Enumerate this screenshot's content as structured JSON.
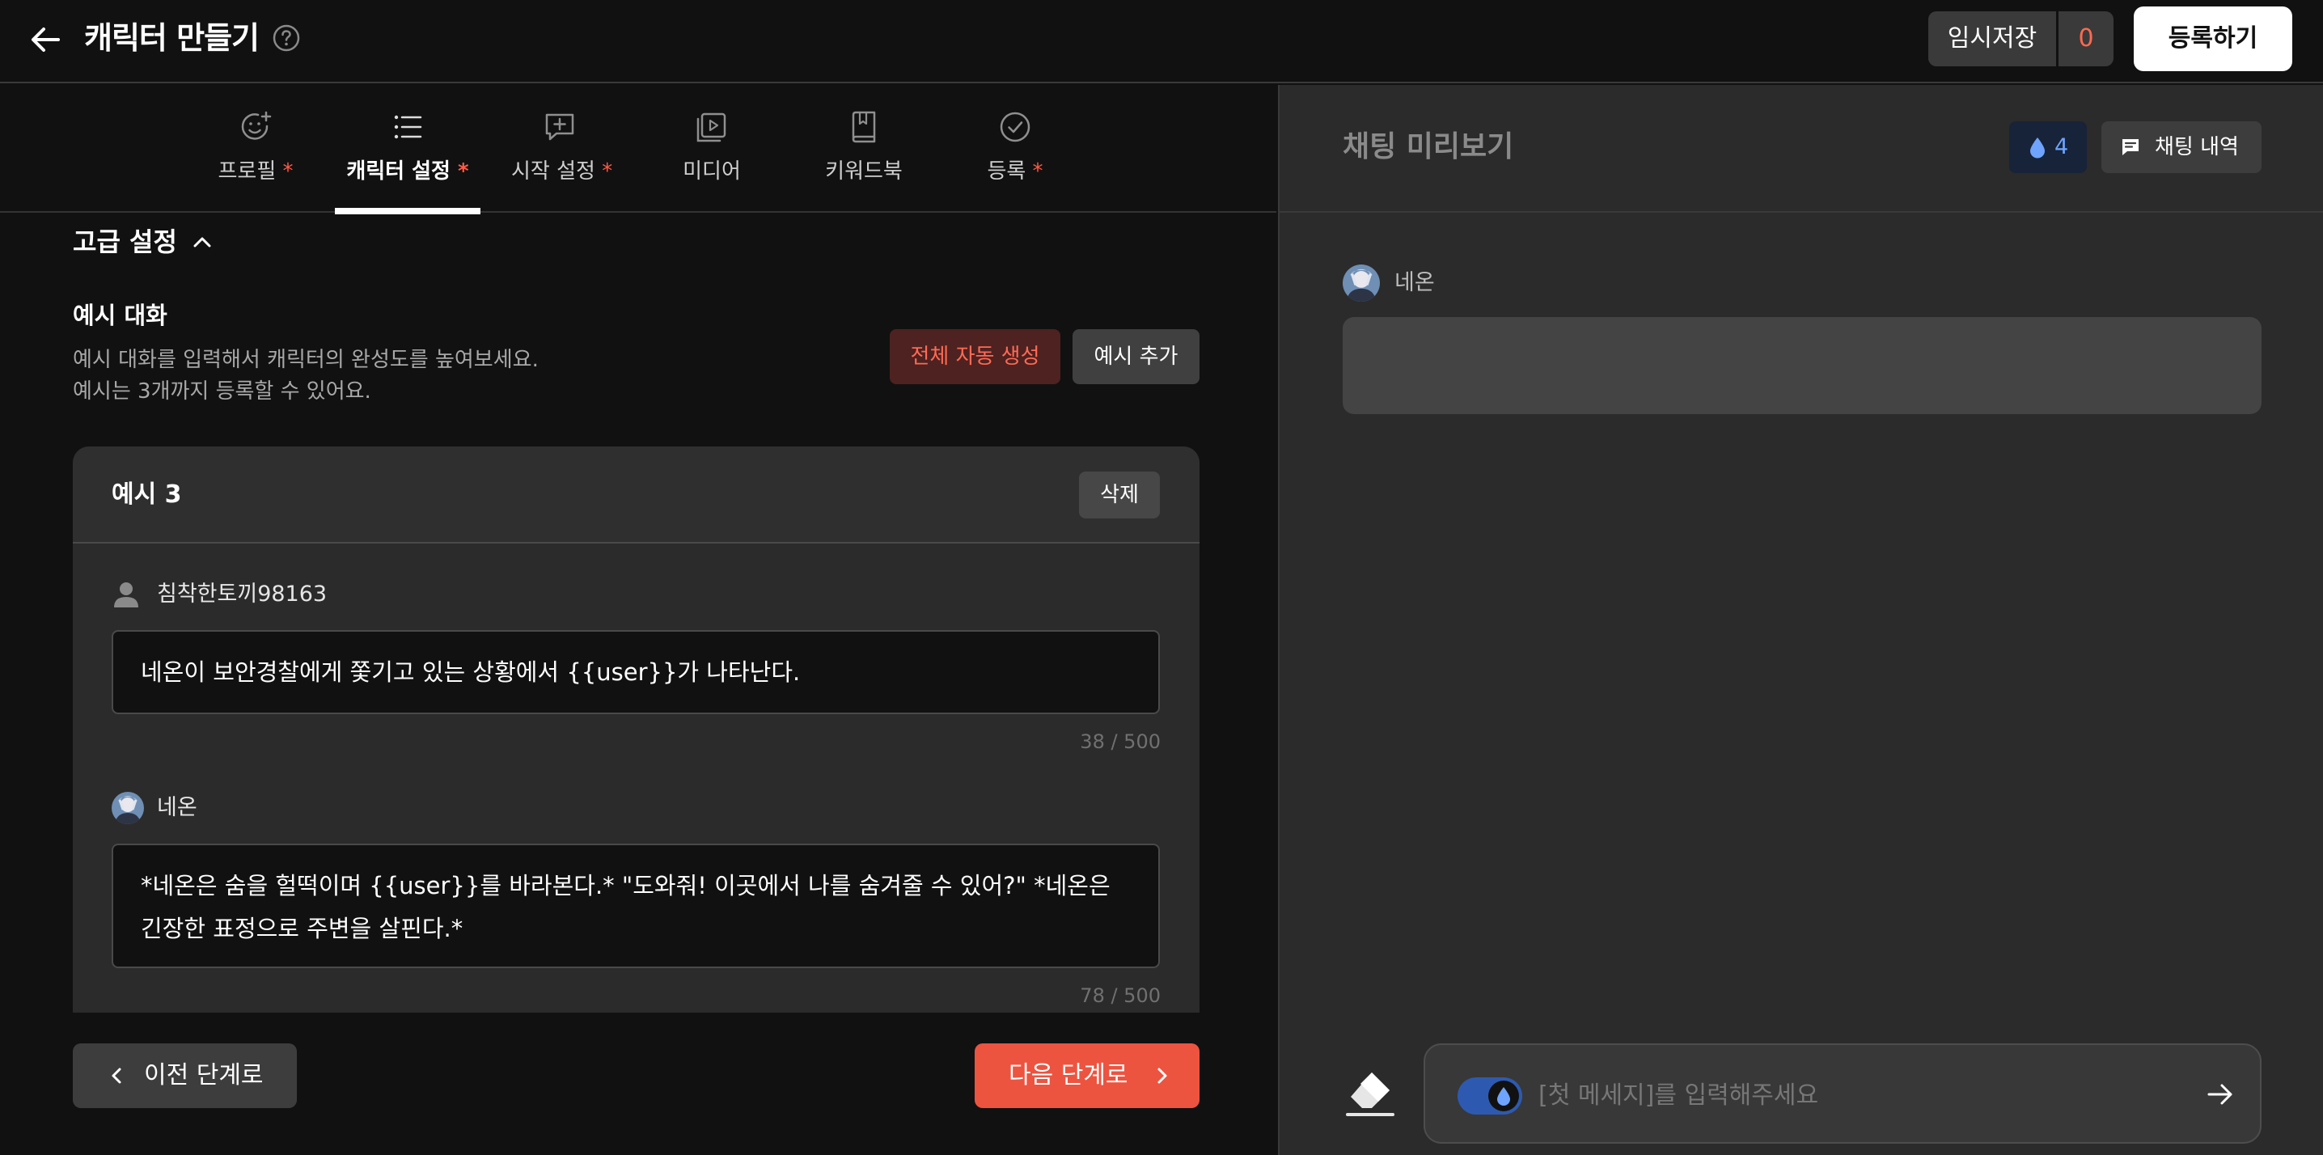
{
  "header": {
    "title": "캐릭터 만들기",
    "draft_label": "임시저장",
    "draft_count": "0",
    "register_label": "등록하기"
  },
  "tabs": [
    {
      "label": "프로필",
      "required": "*",
      "icon": "smile-plus-icon"
    },
    {
      "label": "캐릭터 설정",
      "required": "*",
      "icon": "list-icon"
    },
    {
      "label": "시작 설정",
      "required": "*",
      "icon": "message-plus-icon"
    },
    {
      "label": "미디어",
      "required": "",
      "icon": "play-media-icon"
    },
    {
      "label": "키워드북",
      "required": "",
      "icon": "book-icon"
    },
    {
      "label": "등록",
      "required": "*",
      "icon": "check-circle-icon"
    }
  ],
  "advanced": {
    "title": "고급 설정"
  },
  "examples": {
    "title": "예시 대화",
    "desc_line1": "예시 대화를 입력해서 캐릭터의 완성도를 높여보세요.",
    "desc_line2": "예시는 3개까지 등록할 수 있어요.",
    "auto_generate_label": "전체 자동 생성",
    "add_label": "예시 추가",
    "card": {
      "title": "예시 3",
      "delete_label": "삭제",
      "user_name": "침착한토끼98163",
      "user_message": "네온이 보안경찰에게 쫓기고 있는 상황에서 {{user}}가 나타난다.",
      "user_count": "38 / 500",
      "char_name": "네온",
      "char_message": "*네온은 숨을 헐떡이며 {{user}}를 바라본다.* \"도와줘! 이곳에서 나를 숨겨줄 수 있어?\" *네온은 긴장한 표정으로 주변을 살핀다.*",
      "char_count": "78 / 500"
    }
  },
  "footer": {
    "prev_label": "이전 단계로",
    "next_label": "다음 단계로"
  },
  "preview": {
    "title": "채팅 미리보기",
    "drop_count": "4",
    "history_label": "채팅 내역",
    "char_name": "네온",
    "input_placeholder": "[첫 메세지]를 입력해주세요"
  },
  "colors": {
    "accent": "#ec5440",
    "required": "#ff5a45",
    "drop_blue": "#6ea4ff",
    "toggle_blue": "#2d5ab0"
  }
}
